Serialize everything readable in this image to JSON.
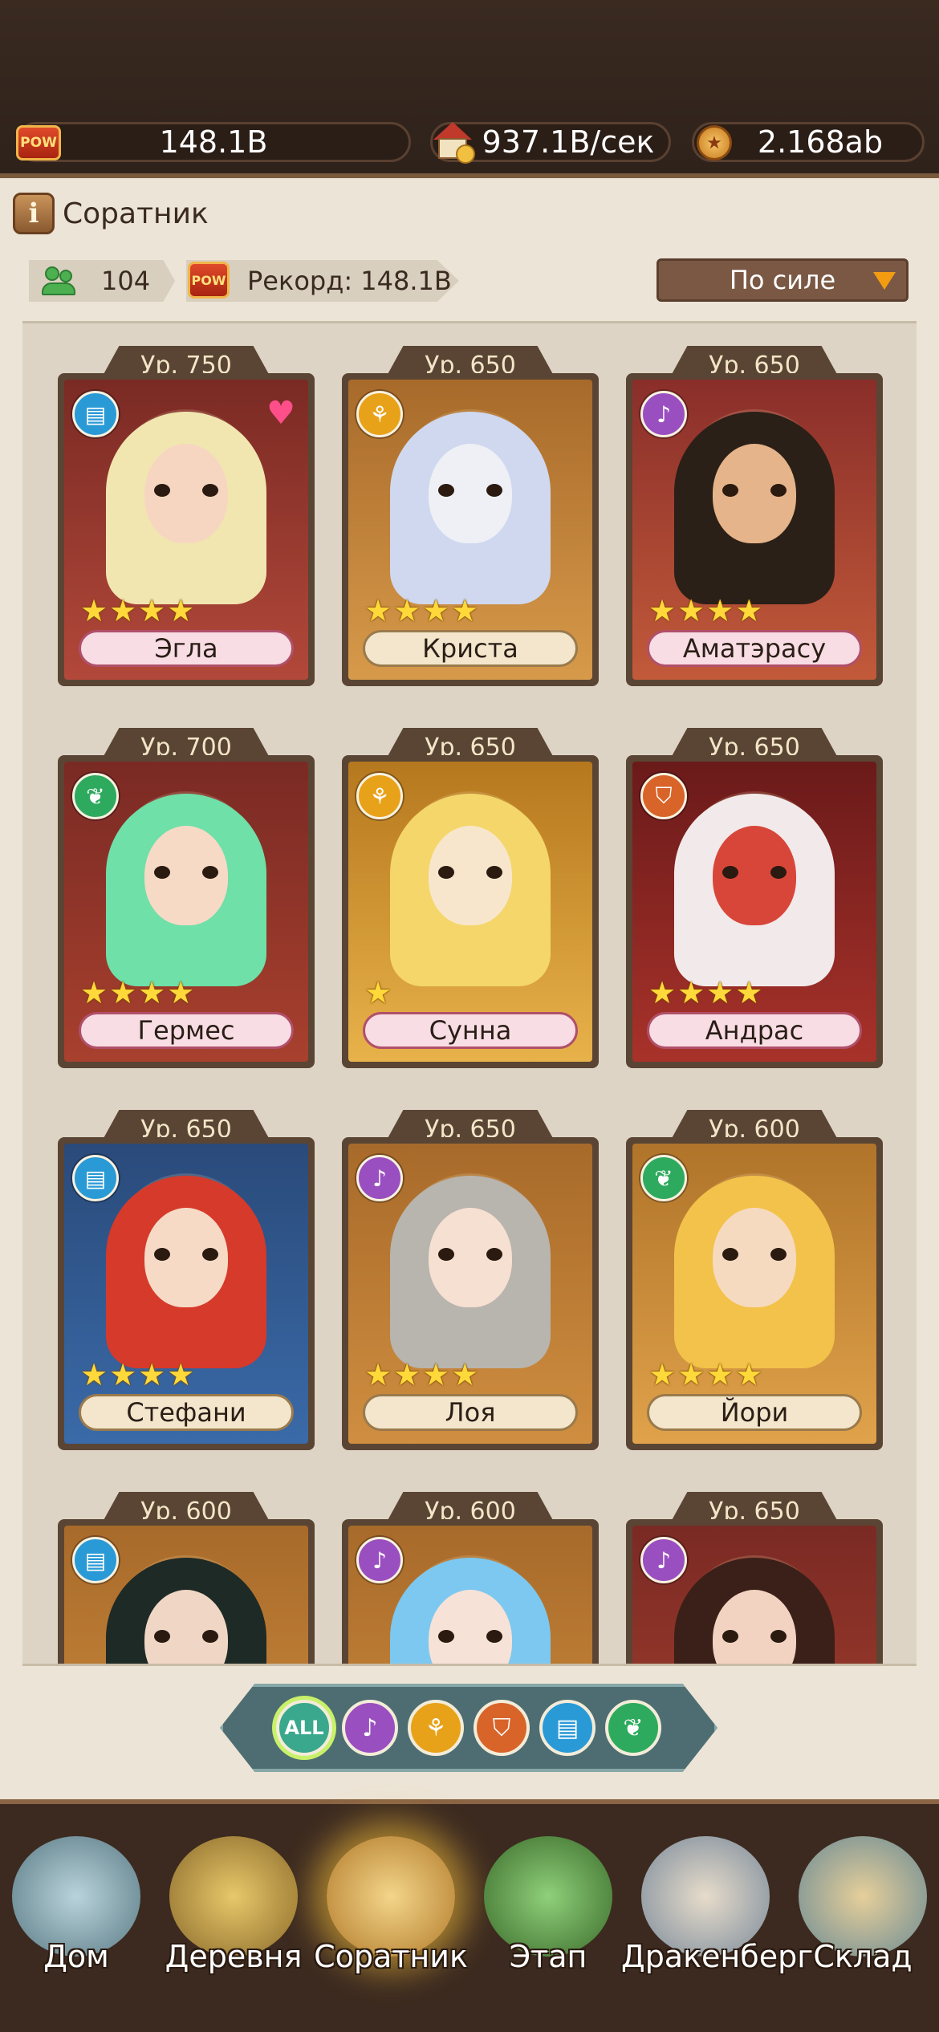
{
  "resources": {
    "power": "148.1B",
    "income": "937.1B/сек",
    "gold": "2.168ab",
    "pow_label": "POW"
  },
  "header": {
    "title": "Соратник",
    "info_symbol": "i"
  },
  "stats": {
    "count": "104",
    "record": "Рекорд: 148.1B"
  },
  "sort": {
    "label": "По силе"
  },
  "heroes": [
    {
      "level": "Ур. 750",
      "name": "Эгла",
      "stars": 4,
      "class": "book-icon",
      "favorite": true
    },
    {
      "level": "Ур. 650",
      "name": "Криста",
      "stars": 4,
      "class": "broom-icon",
      "favorite": false
    },
    {
      "level": "Ур. 650",
      "name": "Аматэрасу",
      "stars": 4,
      "class": "harp-icon",
      "favorite": false
    },
    {
      "level": "Ур. 700",
      "name": "Гермес",
      "stars": 4,
      "class": "wing-icon",
      "favorite": false
    },
    {
      "level": "Ур. 650",
      "name": "Сунна",
      "stars": 1,
      "class": "broom-icon",
      "favorite": false
    },
    {
      "level": "Ур. 650",
      "name": "Андрас",
      "stars": 4,
      "class": "shield-icon",
      "favorite": false
    },
    {
      "level": "Ур. 650",
      "name": "Стефани",
      "stars": 4,
      "class": "book-icon",
      "favorite": false
    },
    {
      "level": "Ур. 650",
      "name": "Лоя",
      "stars": 4,
      "class": "harp-icon",
      "favorite": false
    },
    {
      "level": "Ур. 600",
      "name": "Йори",
      "stars": 4,
      "class": "wing-icon",
      "favorite": false
    },
    {
      "level": "Ур. 600",
      "name": "",
      "stars": 0,
      "class": "book-icon",
      "favorite": false
    },
    {
      "level": "Ур. 600",
      "name": "",
      "stars": 0,
      "class": "harp-icon",
      "favorite": false
    },
    {
      "level": "Ур. 650",
      "name": "",
      "stars": 0,
      "class": "harp-icon",
      "favorite": false
    }
  ],
  "filters": {
    "all_label": "ALL",
    "items": [
      "harp-icon",
      "broom-icon",
      "shield-icon",
      "book-icon",
      "wing-icon"
    ]
  },
  "nav": {
    "items": [
      {
        "label": "Дом"
      },
      {
        "label": "Деревня"
      },
      {
        "label": "Соратник",
        "active": true
      },
      {
        "label": "Этап"
      },
      {
        "label": "Дракенберг"
      },
      {
        "label": "Склад"
      }
    ]
  },
  "colors": {
    "book": "#2a9ad6",
    "broom": "#e8a21a",
    "harp": "#9a4fc0",
    "wing": "#2eaa5e",
    "shield": "#d8642a",
    "star": "#ffd93a"
  }
}
